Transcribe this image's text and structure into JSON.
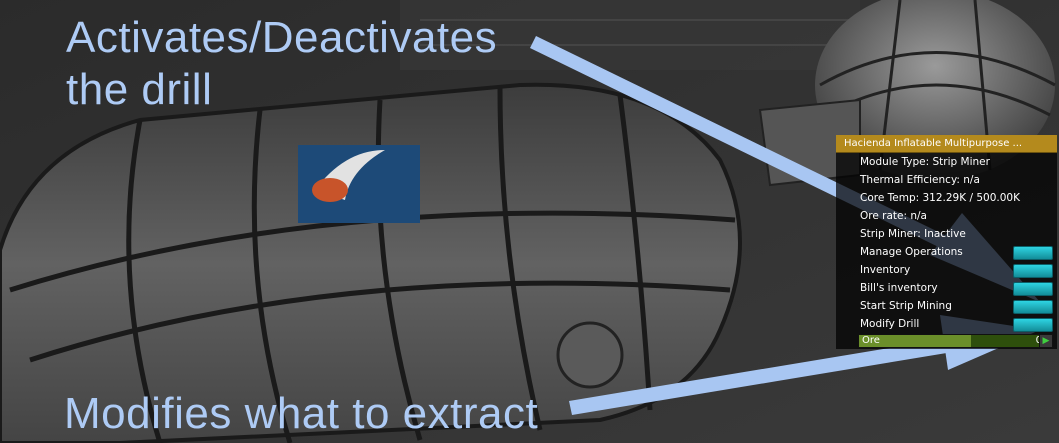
{
  "callouts": {
    "top_line1": "Activates/Deactivates",
    "top_line2": "the drill",
    "bottom": "Modifies what to extract"
  },
  "part_window": {
    "title": "Hacienda Inflatable Multipurpose ...",
    "rows": [
      {
        "text": "Module Type: Strip Miner",
        "has_button": false
      },
      {
        "text": "Thermal Efficiency: n/a",
        "has_button": false
      },
      {
        "text": "Core Temp: 312.29K / 500.00K",
        "has_button": false
      },
      {
        "text": "Ore rate: n/a",
        "has_button": false
      },
      {
        "text": "Strip Miner: Inactive",
        "has_button": false
      },
      {
        "text": "Manage Operations",
        "has_button": true
      },
      {
        "text": "Inventory",
        "has_button": true
      },
      {
        "text": "Bill's inventory",
        "has_button": true
      },
      {
        "text": "Start Strip Mining",
        "has_button": true
      },
      {
        "text": "Modify Drill",
        "has_button": true
      }
    ],
    "resource": {
      "name": "Ore",
      "value": "0",
      "fill_fraction": 0.6
    }
  },
  "colors": {
    "callout_text": "#aecbf5",
    "arrow": "#a8c6f2",
    "title_bar": "#b48a1d",
    "button": "#1bb3c2",
    "resource_bar": "#2e4f0c"
  },
  "icons": {
    "play": "play-icon"
  }
}
